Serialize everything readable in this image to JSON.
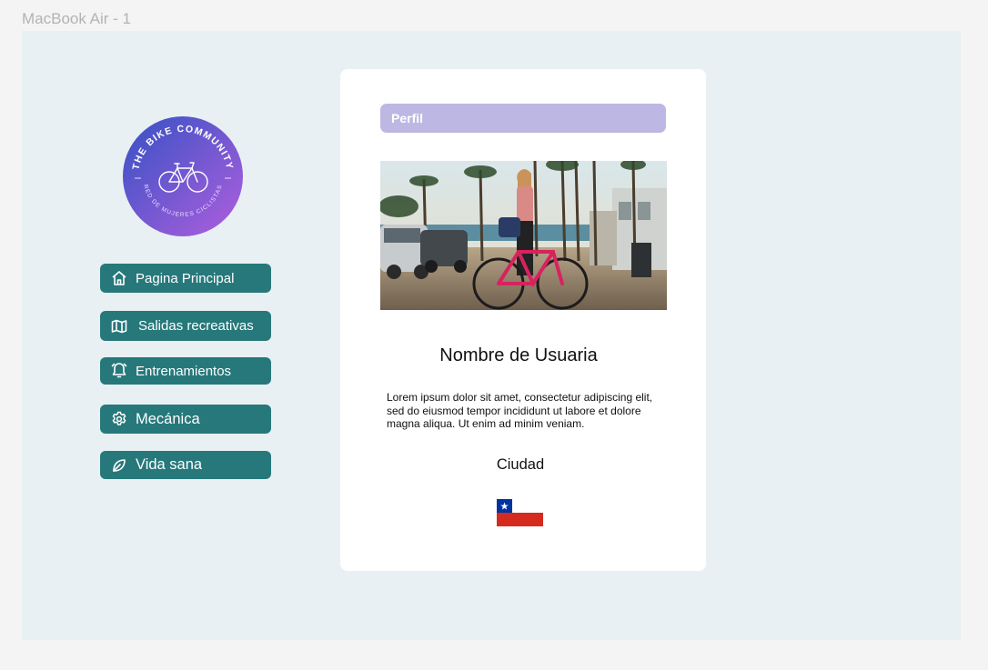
{
  "frame": {
    "label": "MacBook Air - 1"
  },
  "logo": {
    "top_text": "THE BIKE COMMUNITY",
    "bottom_text": "RED DE MUJERES CICLISTAS",
    "colors": {
      "start": "#3e55c7",
      "end": "#a35ddc"
    }
  },
  "nav": {
    "items": [
      {
        "label": "Pagina Principal",
        "icon": "home-icon"
      },
      {
        "label": "Salidas recreativas",
        "icon": "map-icon"
      },
      {
        "label": "Entrenamientos",
        "icon": "alarm-clock-icon"
      },
      {
        "label": "Mecánica",
        "icon": "gear-icon"
      },
      {
        "label": "Vida sana",
        "icon": "leaf-icon"
      }
    ],
    "color": "#26787a"
  },
  "profile": {
    "tab_label": "Perfil",
    "tab_color": "#bcb8e3",
    "username": "Nombre de Usuaria",
    "bio": "Lorem ipsum dolor sit amet, consectetur adipiscing elit, sed do eiusmod tempor incididunt ut labore et dolore magna aliqua. Ut enim ad minim veniam.",
    "city": "Ciudad",
    "flag": "chile-flag"
  }
}
